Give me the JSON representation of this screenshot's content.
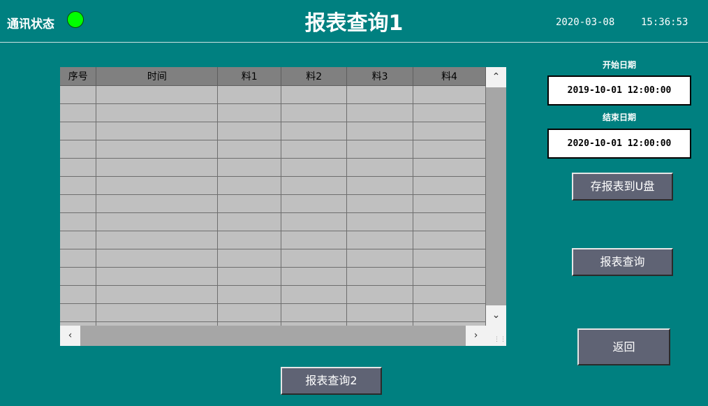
{
  "header": {
    "comm_label": "通讯状态",
    "title": "报表查询1",
    "date": "2020-03-08",
    "time": "15:36:53",
    "comm_led_color": "#00ff00"
  },
  "table": {
    "columns": [
      "序号",
      "时间",
      "料1",
      "料2",
      "料3",
      "料4"
    ]
  },
  "range": {
    "start_label": "开始日期",
    "start_value": "2019-10-01 12:00:00",
    "end_label": "结束日期",
    "end_value": "2020-10-01 12:00:00"
  },
  "buttons": {
    "save_usb": "存报表到U盘",
    "query": "报表查询",
    "back": "返回",
    "query2": "报表查询2"
  },
  "icons": {
    "scroll_up": "chevron-up-icon",
    "scroll_down": "chevron-down-icon",
    "scroll_left": "chevron-left-icon",
    "scroll_right": "chevron-right-icon"
  },
  "colors": {
    "background": "#008080",
    "button": "#5f6374",
    "grid_cell": "#c0c0c0",
    "grid_header": "#808080"
  }
}
